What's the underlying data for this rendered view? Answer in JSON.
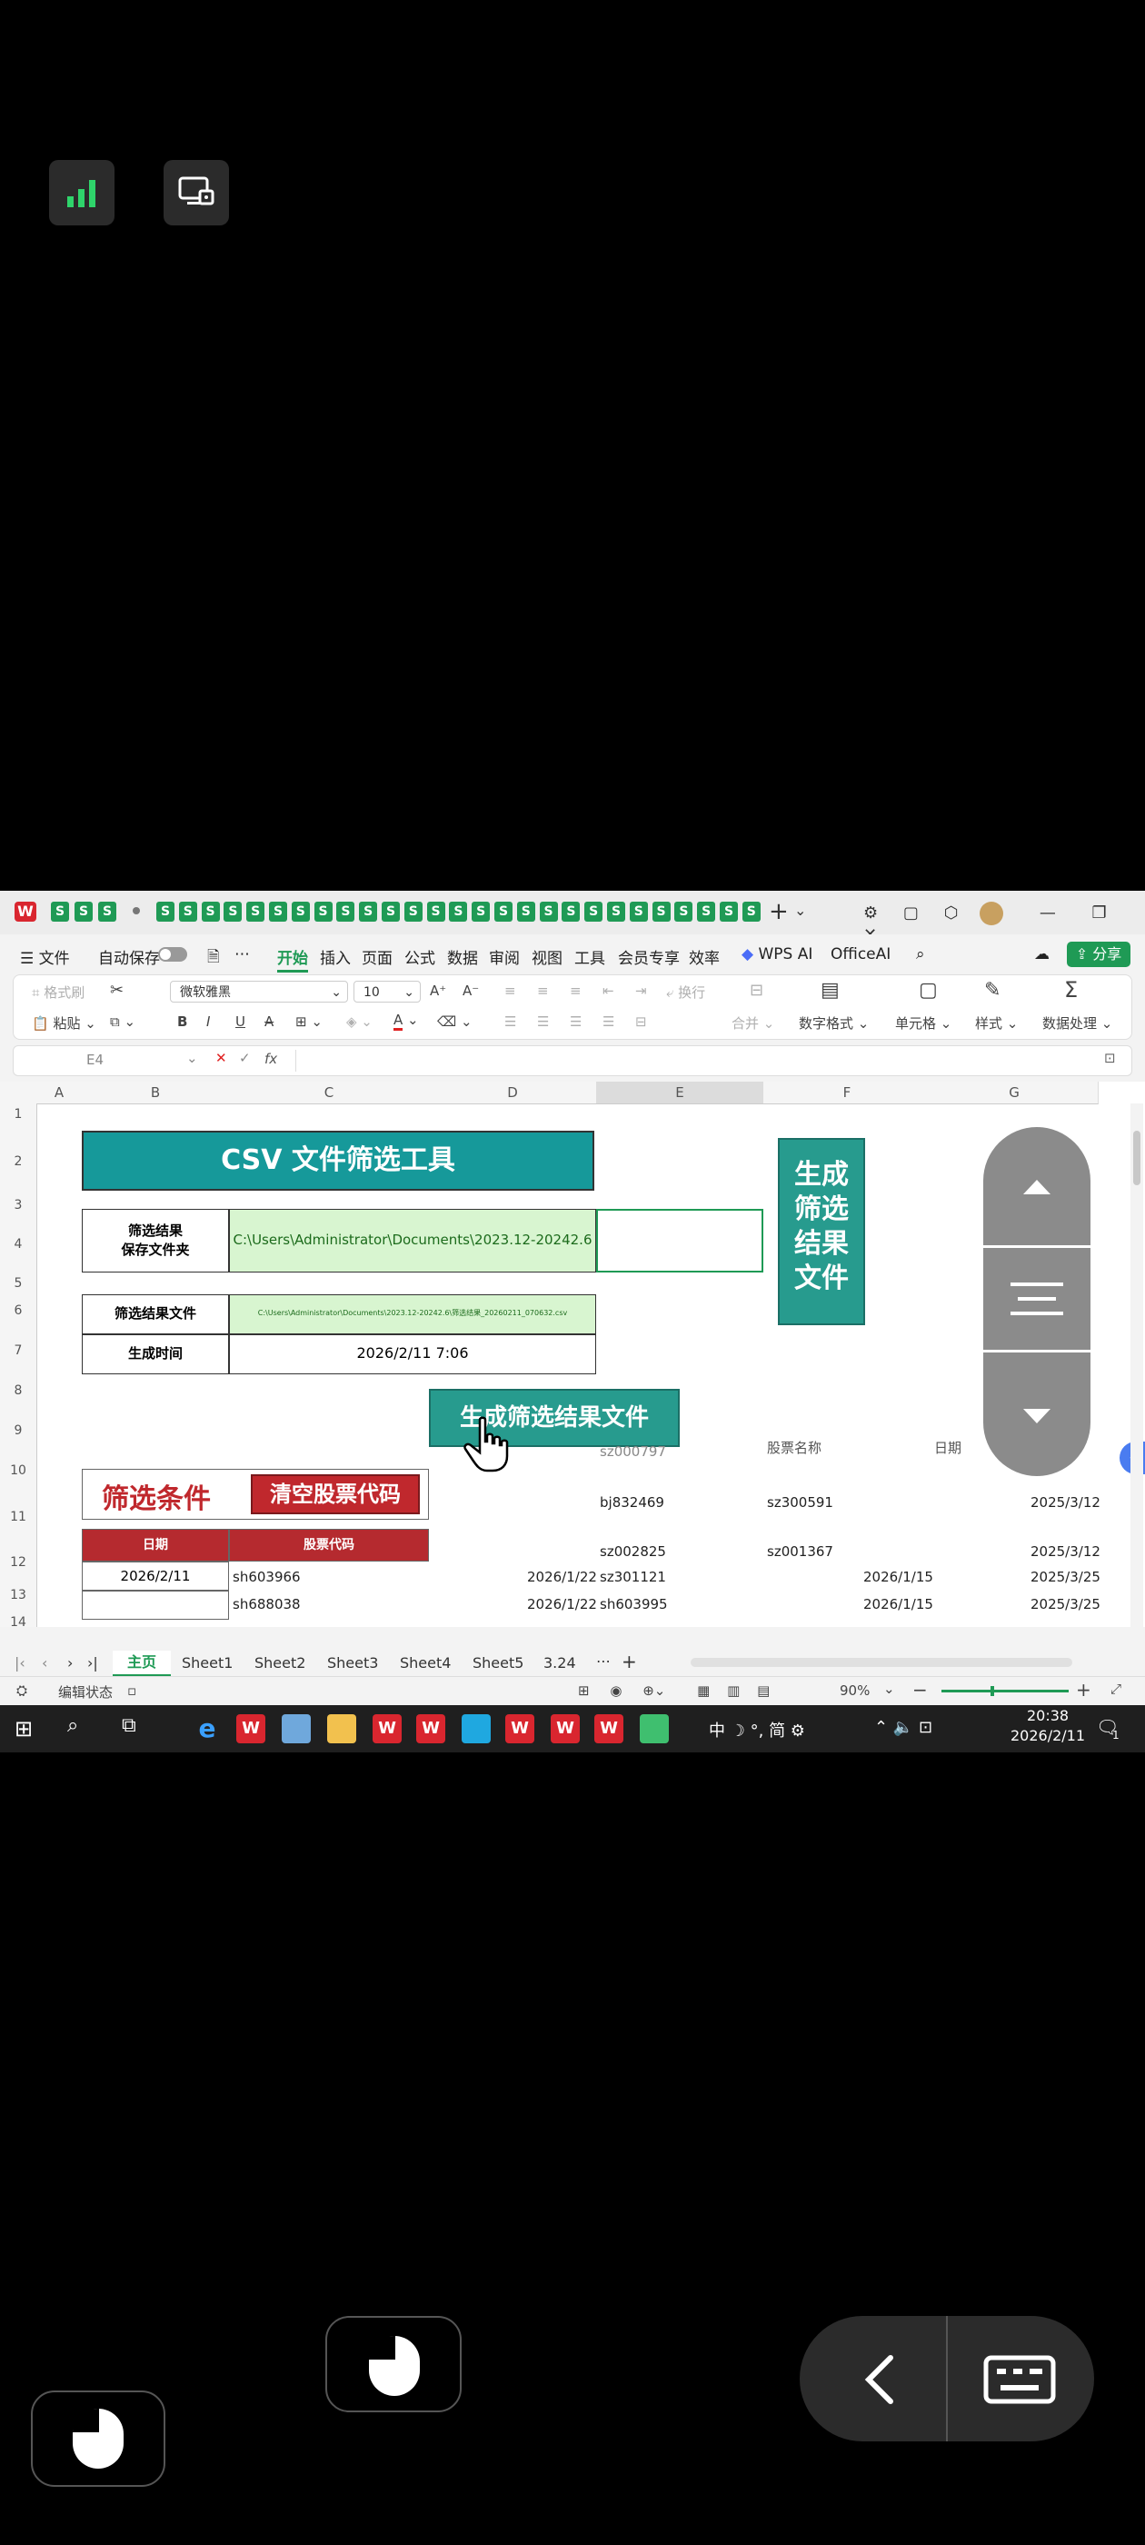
{
  "app": {
    "menu": [
      "文件",
      "自动保存",
      "开始",
      "插入",
      "页面",
      "公式",
      "数据",
      "审阅",
      "视图",
      "工具",
      "会员专享",
      "效率",
      "WPS AI",
      "OfficeAI"
    ],
    "share_label": "分享",
    "tab_letter": "S"
  },
  "ribbon": {
    "format_painter": "格式刷",
    "paste": "粘贴",
    "font_name": "微软雅黑",
    "font_size": "10",
    "wrap": "换行",
    "merge": "合并",
    "number_format": "数字格式",
    "cell": "单元格",
    "style": "样式",
    "data_processing": "数据处理"
  },
  "formula_bar": {
    "name_box": "E4",
    "fx": "fx"
  },
  "sheet": {
    "columns": [
      "A",
      "B",
      "C",
      "D",
      "E",
      "F",
      "G"
    ],
    "rows": [
      "1",
      "2",
      "3",
      "4",
      "5",
      "6",
      "7",
      "8",
      "9",
      "10",
      "11",
      "12",
      "13",
      "14"
    ],
    "title": "CSV 文件筛选工具",
    "save_folder_label_1": "筛选结果",
    "save_folder_label_2": "保存文件夹",
    "save_folder_value": "C:\\Users\\Administrator\\Documents\\2023.12-20242.6",
    "result_file_label": "筛选结果文件",
    "result_file_value": "C:\\Users\\Administrator\\Documents\\2023.12-20242.6\\筛选结果_20260211_070632.csv",
    "gen_time_label": "生成时间",
    "gen_time_value": "2026/2/11 7:06",
    "gen_button_vertical": [
      "生成",
      "筛选",
      "结果",
      "文件"
    ],
    "gen_button": "生成筛选结果文件",
    "filter_condition": "筛选条件",
    "clear_codes": "清空股票代码",
    "col_date": "日期",
    "col_code": "股票代码",
    "header_stock_name": "股票名称",
    "header_date": "日期",
    "partial_e10": "sz000797",
    "row11": {
      "e": "bj832469",
      "f": "sz300591",
      "g": "2025/3/12"
    },
    "row12": {
      "e": "sz002825",
      "f": "sz001367",
      "g": "2025/3/12"
    },
    "row13": {
      "b": "2026/2/11",
      "c": "sh603966",
      "d": "2026/1/22",
      "e": "sz301121",
      "f": "2026/1/15",
      "g": "2025/3/25"
    },
    "row14": {
      "c": "sh688038",
      "d": "2026/1/22",
      "e": "sh603995",
      "f": "2026/1/15",
      "g": "2025/3/25"
    }
  },
  "sheet_tabs": [
    "主页",
    "Sheet1",
    "Sheet2",
    "Sheet3",
    "Sheet4",
    "Sheet5",
    "3.24"
  ],
  "status": {
    "mode": "编辑状态",
    "zoom": "90%"
  },
  "taskbar": {
    "ime": "中",
    "ime2": "简",
    "time": "20:38",
    "date": "2026/2/11",
    "notif": "1"
  },
  "colors": {
    "teal": "#16999a",
    "red": "#c0282d",
    "green_cell": "#d8f5d0"
  }
}
